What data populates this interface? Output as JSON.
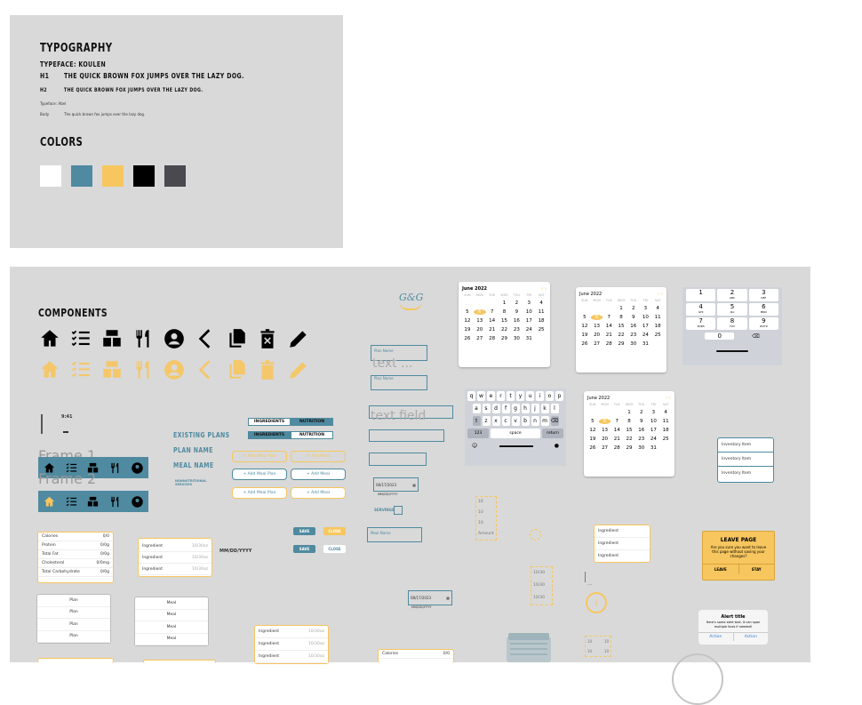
{
  "typography": {
    "title": "TYPOGRAPHY",
    "typeface": "TYPEFACE: KOULEN",
    "h1_tag": "H1",
    "h1_sample": "THE QUICK BROWN FOX JUMPS OVER THE LAZY DOG.",
    "h2_tag": "H2",
    "h2_sample": "THE QUICK BROWN FOX JUMPS OVER THE LAZY DOG.",
    "typeface2": "Typeface: Abel",
    "body_tag": "Body",
    "body_sample": "The quick brown fox jumps over the lazy dog."
  },
  "colors": {
    "title": "COLORS",
    "swatches": [
      "#ffffff",
      "#4f8aa0",
      "#f7c65e",
      "#000000",
      "#4a4950"
    ]
  },
  "components": {
    "title": "COMPONENTS",
    "icons": [
      "home-icon",
      "checklist-icon",
      "boxes-icon",
      "fork-knife-icon",
      "account-icon",
      "back-chevron-icon",
      "copy-icon",
      "delete-icon",
      "pencil-icon"
    ],
    "frame1": "Frame 1",
    "frame2": "Frame 2",
    "status_time": "9:41",
    "existing_plans": "EXISTING PLANS",
    "plan_name": "PLAN NAME",
    "meal_name": "MEAL NAME",
    "nutrition_services": "NONNUTRITIONAL SERVICES",
    "toggle_ingredients": "INGREDIENTS",
    "toggle_nutrition": "NUTRITION",
    "add_meal_plan": "+ Add Meal Plan",
    "add_meal": "+ Add Meal",
    "save": "SAVE",
    "close": "CLOSE",
    "plan_name_field": "Plan Name",
    "text_big": "text ...",
    "text_field": "text field",
    "date_label": "Date",
    "date_value": "08/17/2023",
    "date_hint": "MM/DD/YYYY",
    "servings": "SERVINGS",
    "meal_name_field": "Meal Name",
    "nutrition_rows": [
      {
        "k": "Calories",
        "v": "0/0"
      },
      {
        "k": "Protein",
        "v": "0/0g"
      },
      {
        "k": "Total Fat",
        "v": "0/0g"
      },
      {
        "k": "Cholesterol",
        "v": "0/0mg"
      },
      {
        "k": "Total Carbohydrate",
        "v": "0/0g"
      }
    ],
    "ingredient_rows": [
      {
        "k": "Ingredient",
        "v": "10/30oz"
      },
      {
        "k": "Ingredient",
        "v": "10/30oz"
      },
      {
        "k": "Ingredient",
        "v": "10/30oz"
      }
    ],
    "mm_text": "MM/DD/YYYY",
    "plan_items": [
      "Plan",
      "Plan",
      "Plan",
      "Plan"
    ],
    "meal_items": [
      "Meal",
      "Meal",
      "Meal",
      "Meal"
    ],
    "inventory_items": [
      "Inventory Item",
      "Inventory Item",
      "Inventory Item"
    ],
    "ingredient_list": [
      "Ingredient",
      "Ingredient",
      "Ingredient"
    ],
    "amount_label": "Amount",
    "steps": [
      "10",
      "10",
      "10"
    ],
    "fractions": [
      "10/30",
      "10/30",
      "10/30"
    ],
    "leave_title": "LEAVE PAGE",
    "leave_body": "Are you sure you want to leave this page without saving your changes?",
    "leave": "LEAVE",
    "stay": "STAY",
    "alert_title": "Alert title",
    "alert_body": "Here's some alert text. It can span multiple lines if needed!",
    "action": "Action",
    "logo": "G&G",
    "calendar": {
      "month": "June 2022",
      "dows": [
        "SUN",
        "MON",
        "TUE",
        "WED",
        "THU",
        "FRI",
        "SAT"
      ],
      "days": [
        "",
        "",
        "",
        "1",
        "2",
        "3",
        "4",
        "5",
        "6",
        "7",
        "8",
        "9",
        "10",
        "11",
        "12",
        "13",
        "14",
        "15",
        "16",
        "17",
        "18",
        "19",
        "20",
        "21",
        "22",
        "23",
        "24",
        "25",
        "26",
        "27",
        "28",
        "29",
        "30",
        "31",
        ""
      ]
    },
    "keyboard": {
      "row1": [
        "q",
        "w",
        "e",
        "r",
        "t",
        "y",
        "u",
        "i",
        "o",
        "p"
      ],
      "row2": [
        "a",
        "s",
        "d",
        "f",
        "g",
        "h",
        "j",
        "k",
        "l"
      ],
      "row3": [
        "z",
        "x",
        "c",
        "v",
        "b",
        "n",
        "m"
      ],
      "num": "123",
      "space": "space",
      "return": "return"
    },
    "numpad": [
      {
        "d": "1",
        "l": ""
      },
      {
        "d": "2",
        "l": "ABC"
      },
      {
        "d": "3",
        "l": "DEF"
      },
      {
        "d": "4",
        "l": "GHI"
      },
      {
        "d": "5",
        "l": "JKL"
      },
      {
        "d": "6",
        "l": "MNO"
      },
      {
        "d": "7",
        "l": "PQRS"
      },
      {
        "d": "8",
        "l": "TUV"
      },
      {
        "d": "9",
        "l": "WXYZ"
      }
    ],
    "numpad_zero": "0"
  }
}
